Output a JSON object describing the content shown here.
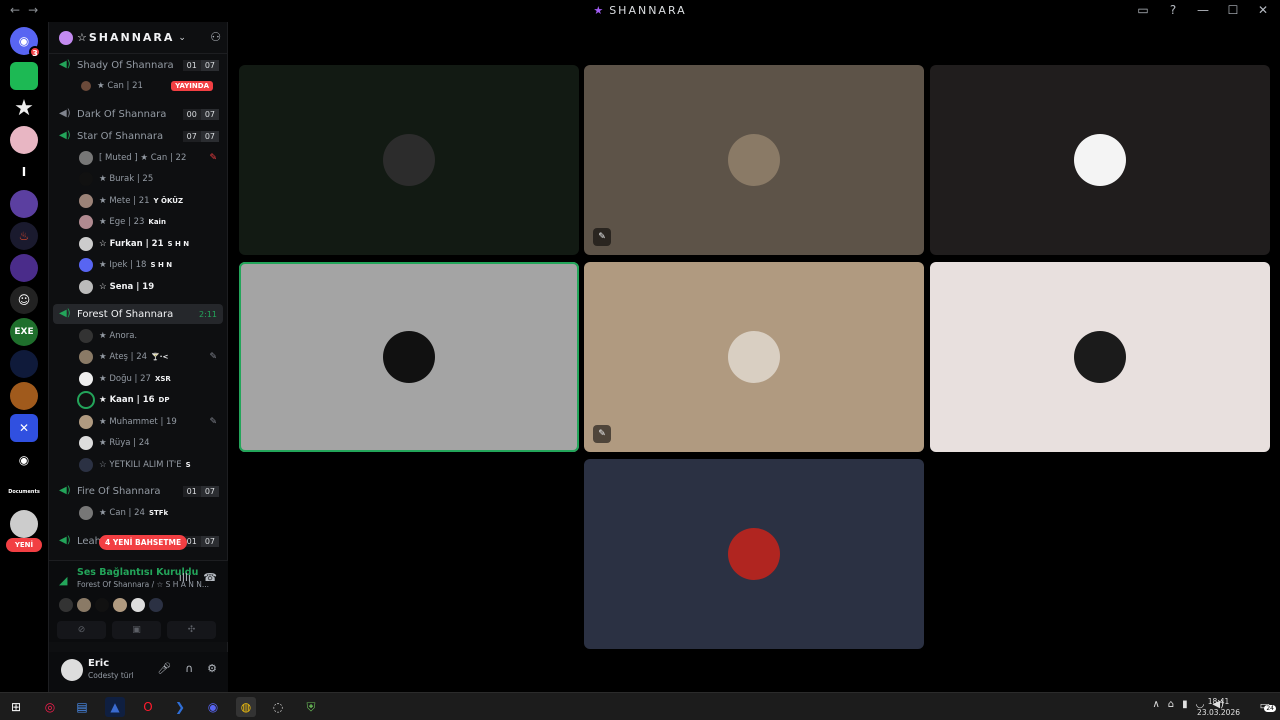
{
  "window": {
    "title": "SHANNARA",
    "title_star": "★",
    "nav_back": "←",
    "nav_forward": "→",
    "icons": [
      "inbox-icon",
      "help-icon",
      "minimize-icon",
      "maximize-icon",
      "close-icon"
    ],
    "icon_glyphs": [
      "▭",
      "?",
      "—",
      "☐",
      "✕"
    ]
  },
  "guilds": {
    "badge": "3",
    "new_pill": "YENİ",
    "items": [
      "discord-home",
      "green-server",
      "star-server",
      "pink-server",
      "i-server",
      "gaming-server",
      "java-server",
      "purple-server",
      "ghost-server",
      "exe-server",
      "blue-server",
      "orange-server",
      "x-server",
      "discord-server",
      "documents-server",
      "gear-server"
    ],
    "labels": [
      "",
      "",
      "★",
      "",
      "I",
      "",
      "",
      "",
      "",
      "EXE",
      "",
      "",
      "",
      "",
      "Documents",
      ""
    ]
  },
  "server": {
    "name": "☆SHANNARA",
    "chevron": "⌄"
  },
  "channels": [
    {
      "name": "Shady Of Shannara",
      "count_a": "01",
      "count_b": "07",
      "active": false
    },
    {
      "name": "Dark Of Shannara",
      "count_a": "00",
      "count_b": "07",
      "active": false
    },
    {
      "name": "Star Of Shannara",
      "count_a": "07",
      "count_b": "07",
      "active": false
    },
    {
      "name": "Forest Of Shannara",
      "timer": "2:11",
      "active": true
    },
    {
      "name": "Fire Of Shannara",
      "count_a": "01",
      "count_b": "07",
      "active": false
    },
    {
      "name": "Leah",
      "count_a": "01",
      "count_b": "07",
      "active": false
    }
  ],
  "live_badge": "YAYINDA",
  "members": {
    "shady": [
      {
        "name": "★ Can | 21"
      }
    ],
    "star": [
      {
        "name": "[ Muted ] ★ Can | 22",
        "tag": "",
        "muted": true
      },
      {
        "name": "★ Burak | 25",
        "tag": ""
      },
      {
        "name": "★ Mete | 21",
        "tag": "Y ÖKÜZ"
      },
      {
        "name": "★ Ege | 23",
        "tag": "Kain"
      },
      {
        "name": "☆ Furkan | 21",
        "tag": "S H N",
        "bold": true
      },
      {
        "name": "★ İpek | 18",
        "tag": "S H N"
      },
      {
        "name": "☆ Sena | 19",
        "tag": "",
        "bold": true
      }
    ],
    "forest": [
      {
        "name": "★ Anora.",
        "tag": ""
      },
      {
        "name": "★ Ateş | 24",
        "tag": "🍸·<",
        "muted": true
      },
      {
        "name": "★ Doğu | 27",
        "tag": "XSR"
      },
      {
        "name": "★ Kaan | 16",
        "tag": "DP",
        "bold": true
      },
      {
        "name": "★ Muhammet | 19",
        "tag": "",
        "muted": true
      },
      {
        "name": "★ Rüya | 24",
        "tag": ""
      },
      {
        "name": "☆ YETKİLİ ALIM İT'E",
        "tag": "S"
      }
    ],
    "fire": [
      {
        "name": "★ Can | 24",
        "tag": "STFk"
      }
    ]
  },
  "mention_pill": "4 YENİ BAHSETME",
  "voice": {
    "status": "Ses Bağlantısı Kuruldu",
    "location": "Forest Of Shannara / ☆ S H A N N..."
  },
  "user": {
    "name": "Eric",
    "status": "Codesty türl"
  },
  "tiles": [
    {
      "bg": "#121a13",
      "avatar_bg": "#2c2c2c",
      "muted": false
    },
    {
      "bg": "#5d5348",
      "avatar_bg": "#8a7a66",
      "muted": true
    },
    {
      "bg": "#201d1d",
      "avatar_bg": "#f4f4f4",
      "muted": false
    },
    {
      "bg": "#a4a4a4",
      "avatar_bg": "#111111",
      "muted": false,
      "speaking": true
    },
    {
      "bg": "#b09a80",
      "avatar_bg": "#d9cfc2",
      "muted": true
    },
    {
      "bg": "#e8e0de",
      "avatar_bg": "#1b1b1b",
      "muted": false
    },
    {
      "bg": "#2b3143",
      "avatar_bg": "#b02520",
      "muted": false
    }
  ],
  "taskbar": {
    "time": "18:41",
    "date": "23.03.2026",
    "notifications": "24",
    "apps": [
      "windows-start",
      "opera-gx",
      "file-explorer",
      "app-a",
      "opera",
      "powershell",
      "discord-app",
      "chrome",
      "edge-dev",
      "shield-app"
    ]
  }
}
